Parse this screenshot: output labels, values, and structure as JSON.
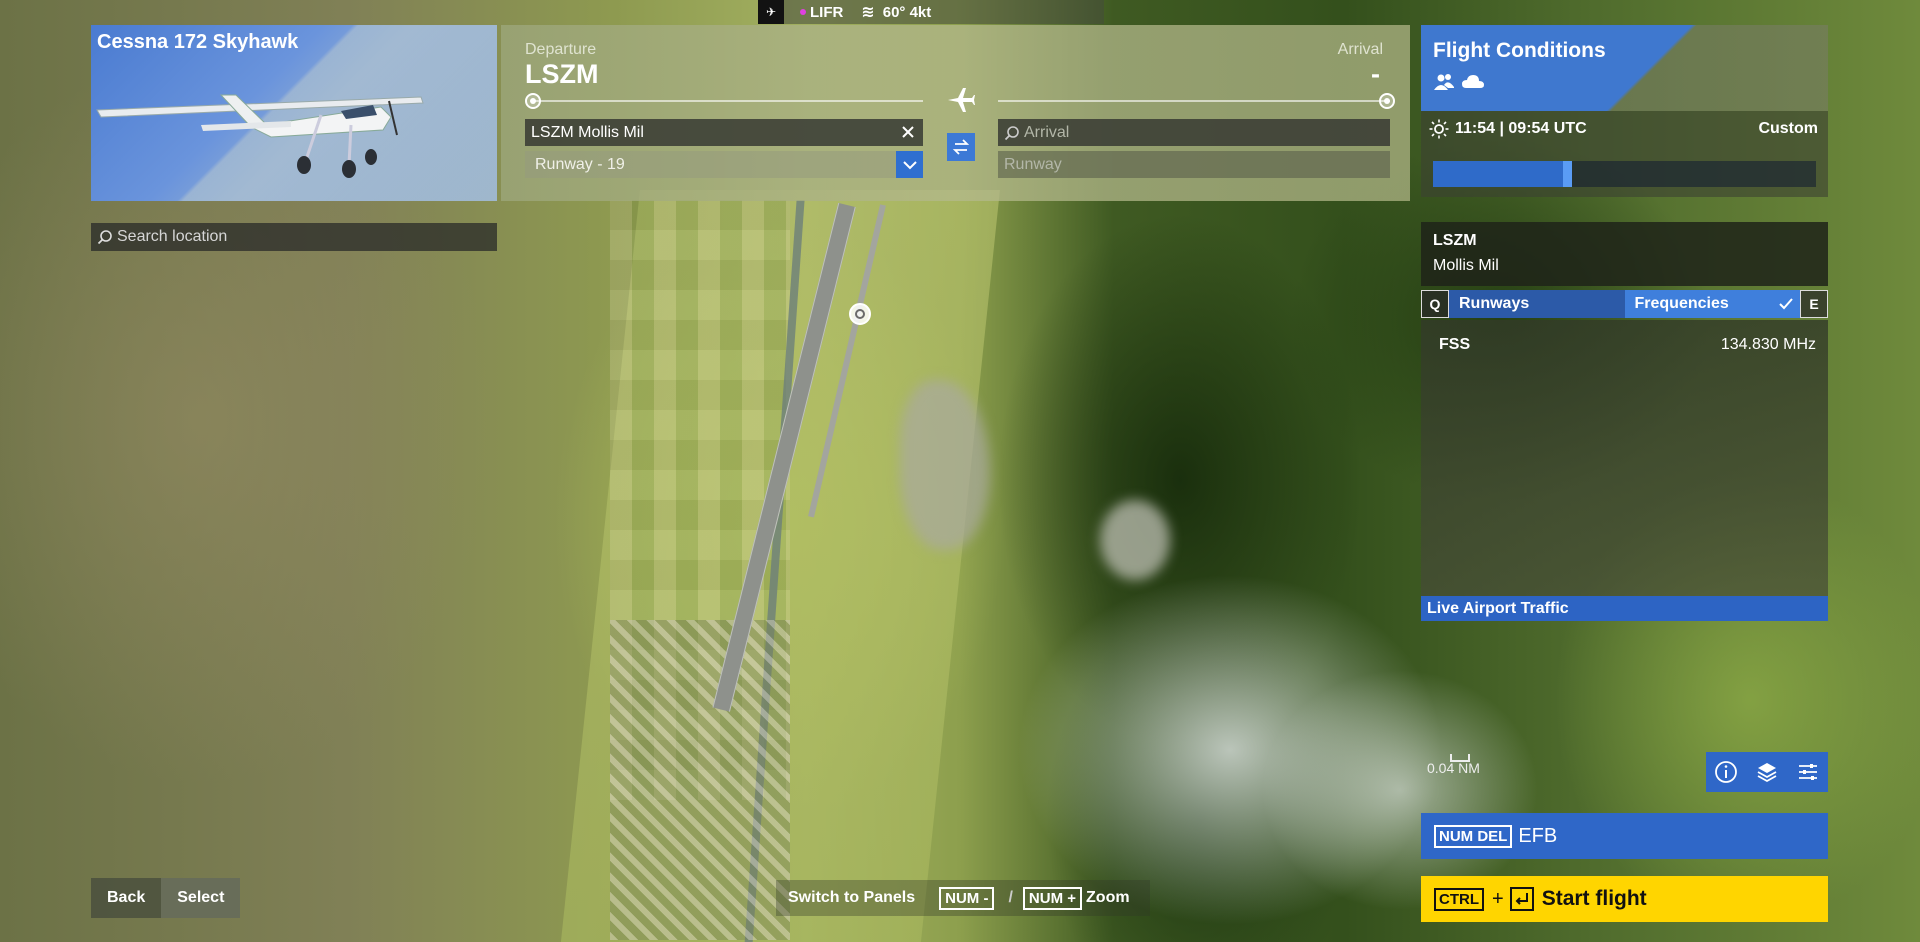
{
  "topbar": {
    "flight_rule": "LIFR",
    "flight_rule_color": "#e040e0",
    "wind": "60° 4kt"
  },
  "aircraft": {
    "name": "Cessna 172 Skyhawk"
  },
  "search": {
    "placeholder": "Search location"
  },
  "route": {
    "departure_label": "Departure",
    "departure_code": "LSZM",
    "arrival_label": "Arrival",
    "arrival_code": "-",
    "departure_field": "LSZM Mollis Mil",
    "departure_runway": "Runway - 19",
    "arrival_placeholder": "Arrival",
    "arrival_runway_placeholder": "Runway"
  },
  "conditions": {
    "title": "Flight Conditions",
    "time": "11:54 | 09:54 UTC",
    "preset": "Custom",
    "time_of_day_fraction": 0.34
  },
  "airport": {
    "icao": "LSZM",
    "name": "Mollis Mil",
    "tab_prev_key": "Q",
    "tab_runways": "Runways",
    "tab_frequencies": "Frequencies",
    "tab_next_key": "E",
    "frequencies": [
      {
        "name": "FSS",
        "value": "134.830 MHz"
      }
    ],
    "live_traffic": "Live Airport Traffic"
  },
  "map": {
    "scale": "0.04 NM"
  },
  "actions": {
    "efb_key": "NUM DEL",
    "efb_label": "EFB",
    "start_key": "CTRL",
    "start_plus": "+",
    "start_label": "Start flight"
  },
  "footer": {
    "back": "Back",
    "select": "Select",
    "switch_panels": "Switch to Panels",
    "num_minus": "NUM -",
    "slash": "/",
    "num_plus": "NUM +",
    "zoom": "Zoom"
  },
  "colors": {
    "accent": "#2f67c8",
    "start": "#ffd500"
  }
}
